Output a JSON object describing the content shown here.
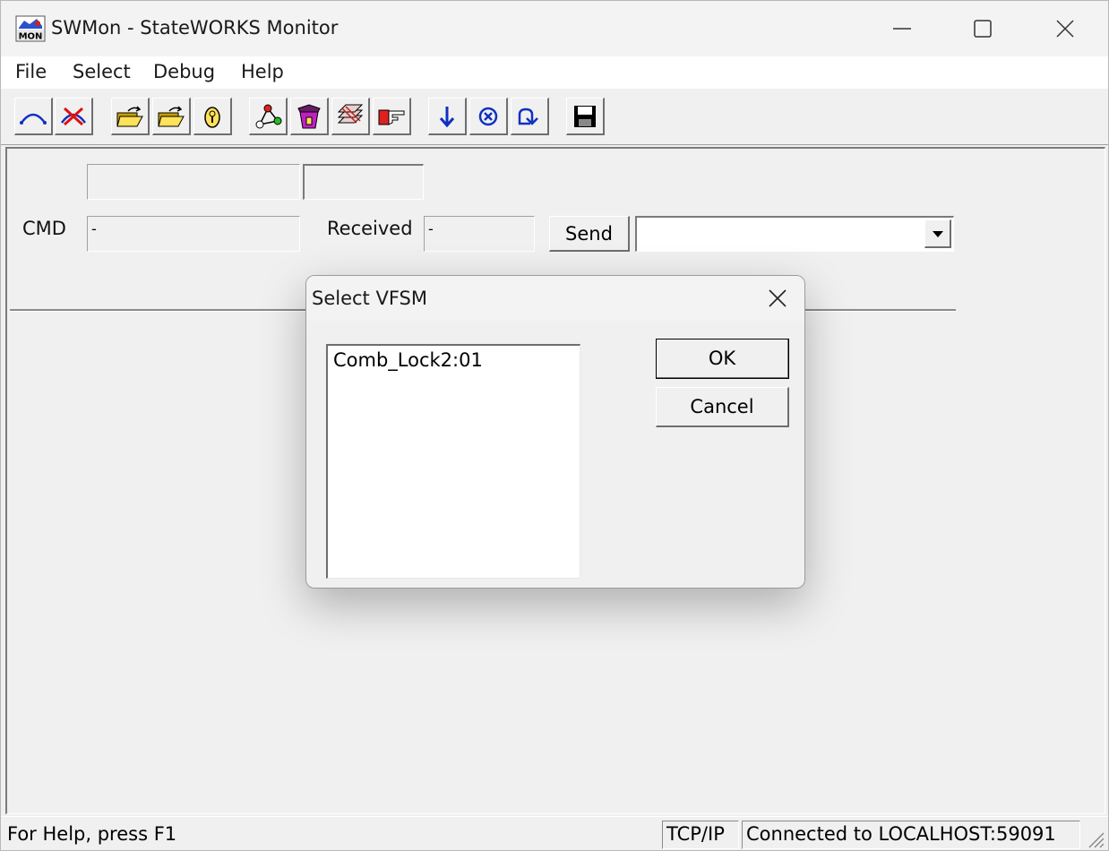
{
  "window": {
    "title": "SWMon - StateWORKS Monitor",
    "app_icon_text": "MON"
  },
  "menu": [
    "File",
    "Select",
    "Debug",
    "Help"
  ],
  "toolbar": {
    "buttons": [
      "connect-icon",
      "disconnect-icon",
      "open-folder-icon",
      "open-folder-2-icon",
      "lock-icon",
      "state-diagram-icon",
      "trash-icon",
      "layers-icon",
      "pointing-hand-icon",
      "step-down-icon",
      "stop-circle-icon",
      "step-over-icon",
      "save-icon"
    ]
  },
  "main": {
    "top_field_1": "",
    "top_field_2": "",
    "cmd_label": "CMD",
    "cmd_value": "-",
    "received_label": "Received",
    "received_value": "-",
    "send_label": "Send",
    "combo_value": ""
  },
  "dialog": {
    "title": "Select VFSM",
    "items": [
      "Comb_Lock2:01"
    ],
    "ok_label": "OK",
    "cancel_label": "Cancel"
  },
  "status": {
    "help": "For Help, press F1",
    "protocol": "TCP/IP",
    "connection": "Connected to  LOCALHOST:59091"
  }
}
